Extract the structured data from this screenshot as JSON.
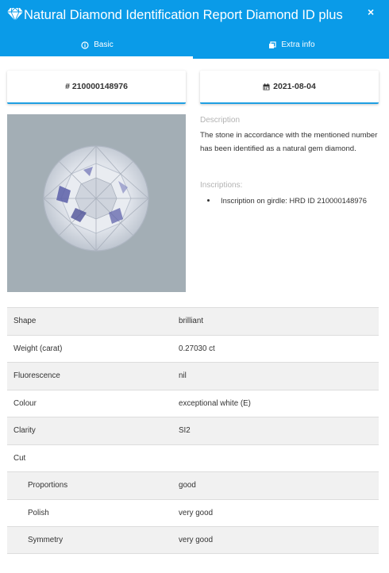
{
  "header": {
    "title": "Natural Diamond Identification Report Diamond ID plus",
    "logo_icon": "diamond-icon",
    "close_icon": "close-icon",
    "close_label": "×",
    "bg_color": "#0a9be8"
  },
  "tabs": [
    {
      "label": "Basic",
      "icon": "info-circle-icon",
      "active": true
    },
    {
      "label": "Extra info",
      "icon": "copy-icon",
      "active": false
    }
  ],
  "report": {
    "number": "# 210000148976",
    "date": "2021-08-04",
    "date_icon": "calendar-icon"
  },
  "description": {
    "label": "Description",
    "text": "The stone in accordance with the mentioned number has been identified as a natural gem diamond."
  },
  "inscriptions": {
    "label": "Inscriptions:",
    "items": [
      "Inscription on girdle: HRD ID 210000148976"
    ]
  },
  "details": [
    {
      "key": "Shape",
      "value": "brilliant"
    },
    {
      "key": "Weight (carat)",
      "value": "0.27030 ct"
    },
    {
      "key": "Fluorescence",
      "value": "nil"
    },
    {
      "key": "Colour",
      "value": "exceptional white (E)"
    },
    {
      "key": "Clarity",
      "value": "SI2"
    },
    {
      "key": "Cut",
      "value": ""
    },
    {
      "key": "Proportions",
      "value": "good"
    },
    {
      "key": "Polish",
      "value": "very good"
    },
    {
      "key": "Symmetry",
      "value": "very good"
    }
  ]
}
